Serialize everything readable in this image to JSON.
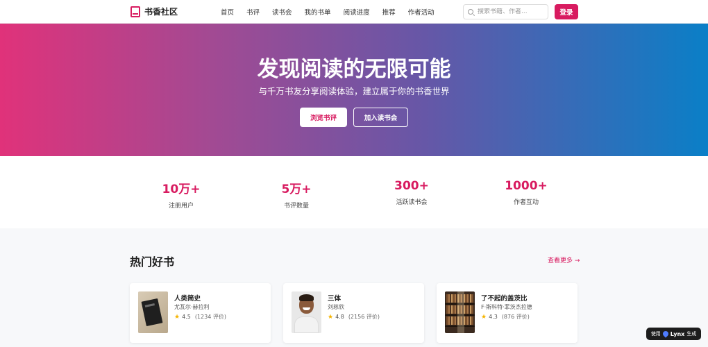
{
  "header": {
    "logo_text": "书香社区",
    "nav": [
      "首页",
      "书评",
      "读书会",
      "我的书单",
      "阅读进度",
      "推荐",
      "作者活动"
    ],
    "search_placeholder": "搜索书籍、作者...",
    "login_label": "登录"
  },
  "hero": {
    "title": "发现阅读的无限可能",
    "subtitle": "与千万书友分享阅读体验，建立属于你的书香世界",
    "primary_button": "浏览书评",
    "secondary_button": "加入读书会",
    "gradient_colors": [
      "#e0327a",
      "#6657a7",
      "#0a7fc7"
    ]
  },
  "stats": [
    {
      "value": "10万+",
      "label": "注册用户"
    },
    {
      "value": "5万+",
      "label": "书评数量"
    },
    {
      "value": "300+",
      "label": "活跃读书会"
    },
    {
      "value": "1000+",
      "label": "作者互动"
    }
  ],
  "section": {
    "title": "热门好书",
    "more_link": "查看更多 →"
  },
  "books": [
    {
      "title": "人类简史",
      "author": "尤瓦尔·赫拉利",
      "rating": "4.5",
      "count": "(1234 评价)"
    },
    {
      "title": "三体",
      "author": "刘慈欣",
      "rating": "4.8",
      "count": "(2156 评价)"
    },
    {
      "title": "了不起的盖茨比",
      "author": "F·斯科特·菲茨杰拉德",
      "rating": "4.3",
      "count": "(876 评价)"
    }
  ],
  "badge": {
    "prefix": "使用",
    "brand": "Lynx",
    "suffix": "生成"
  },
  "colors": {
    "accent": "#d81b60",
    "star": "#f5b400"
  }
}
